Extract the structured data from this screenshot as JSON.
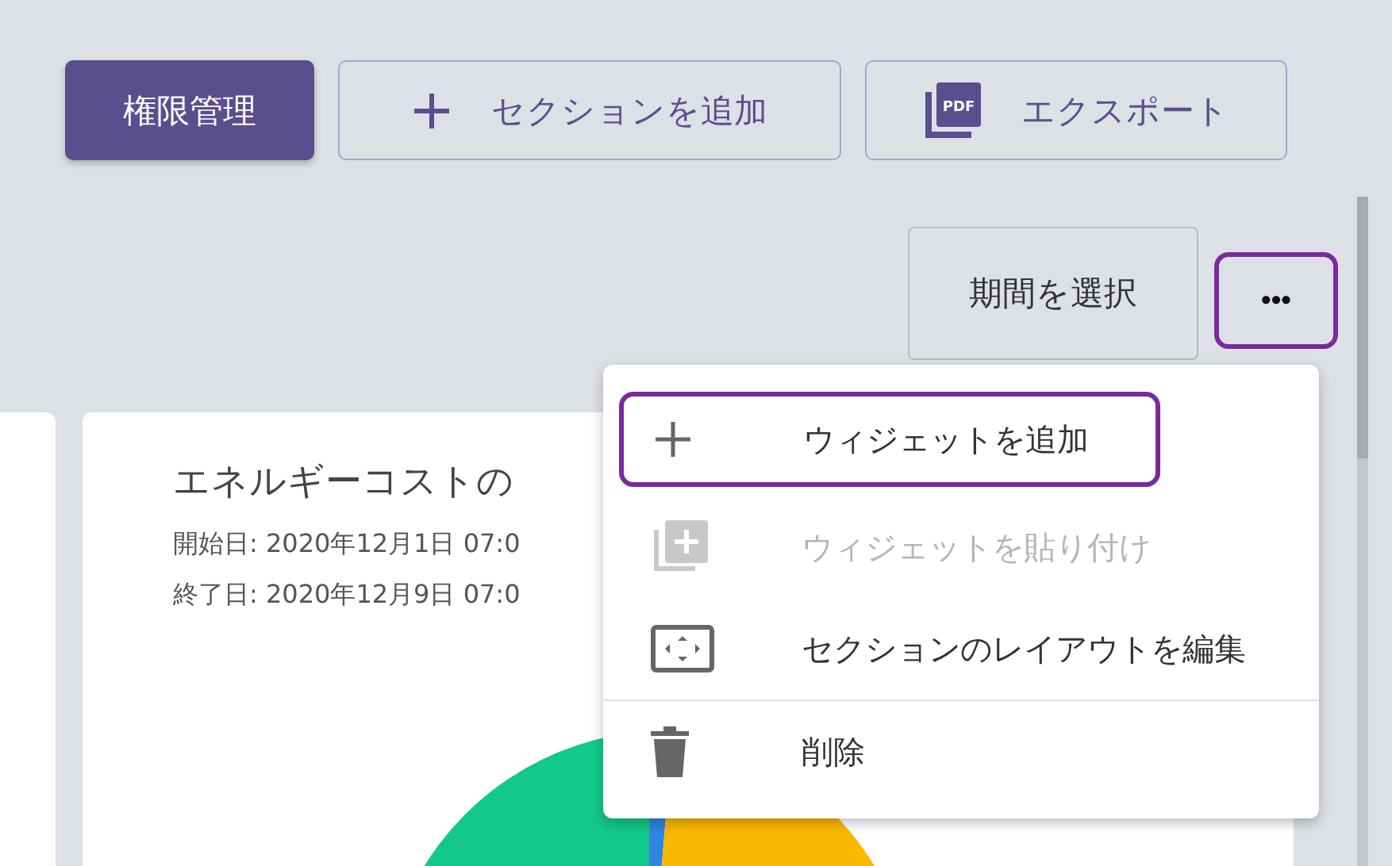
{
  "toolbar": {
    "buttons": [
      {
        "kind": "primary",
        "label": "権限管理"
      },
      {
        "kind": "add",
        "label": "セクションを追加"
      },
      {
        "kind": "pdf",
        "label": "エクスポート",
        "icon_text": "PDF"
      }
    ]
  },
  "period_button": {
    "label": "期間を選択"
  },
  "more_button": {
    "label": "•••",
    "highlighted": true
  },
  "card": {
    "title": "エネルギーコストの",
    "lines": [
      "開始日: 2020年12月1日 07:0",
      "終了日: 2020年12月9日 07:0"
    ]
  },
  "menu": {
    "items": [
      {
        "kind": "add",
        "label": "ウィジェットを追加",
        "disabled": false,
        "highlighted": true,
        "divider_before": false
      },
      {
        "kind": "paste",
        "label": "ウィジェットを貼り付け",
        "disabled": true,
        "highlighted": false,
        "divider_before": false
      },
      {
        "kind": "layout",
        "label": "セクションのレイアウトを編集",
        "disabled": false,
        "highlighted": false,
        "divider_before": false
      },
      {
        "kind": "delete",
        "label": "削除",
        "disabled": false,
        "highlighted": false,
        "divider_before": true
      }
    ]
  }
}
